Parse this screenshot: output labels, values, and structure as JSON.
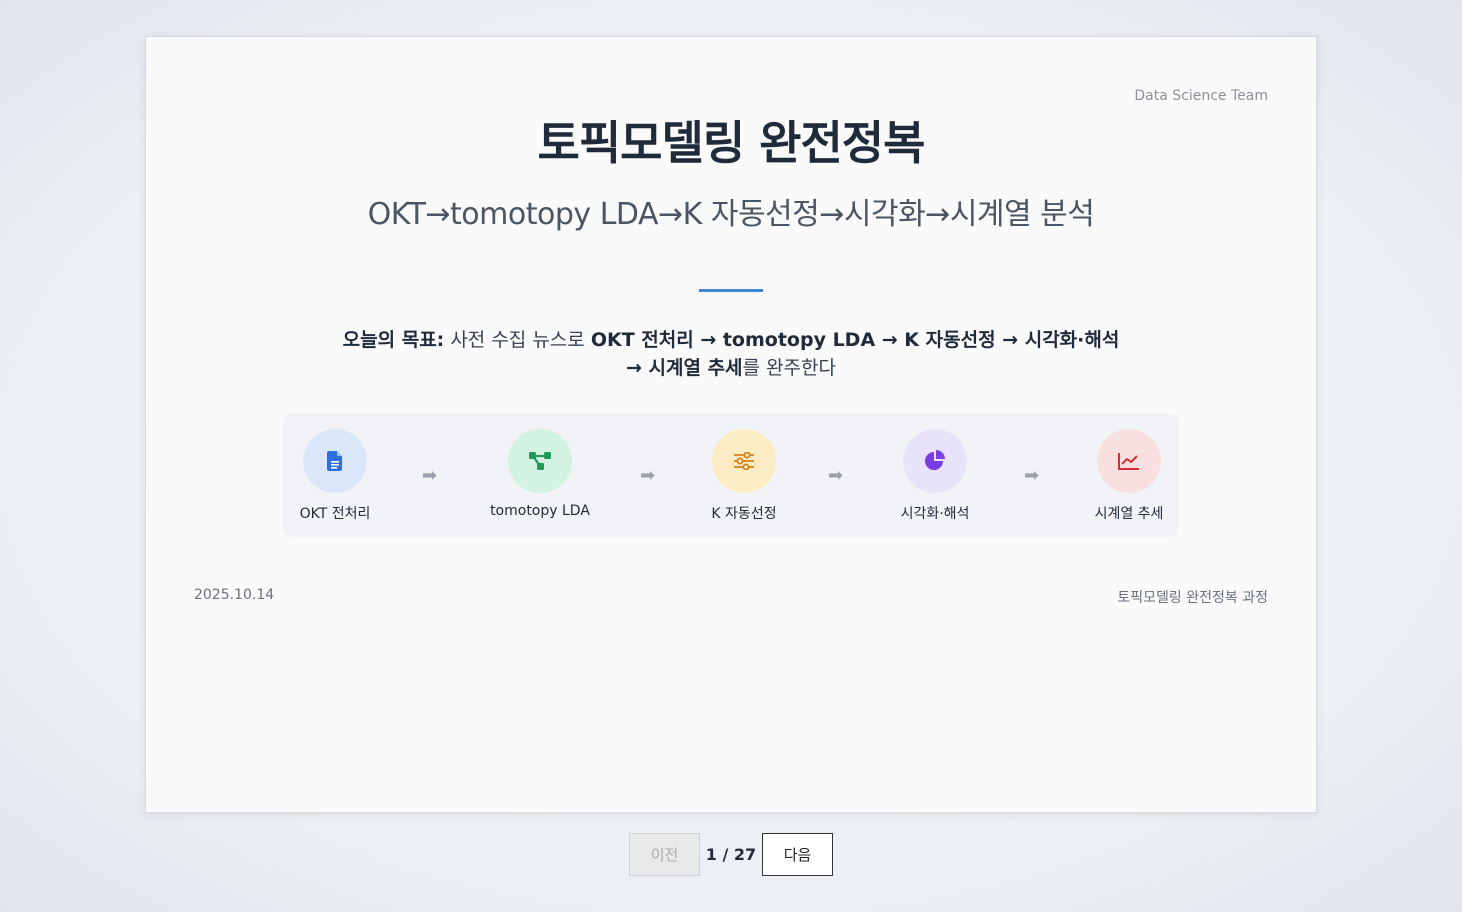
{
  "header": {
    "team": "Data Science Team"
  },
  "slide": {
    "title": "토픽모델링 완전정복",
    "subtitle": "OKT→tomotopy LDA→K 자동선정→시각화→시계열 분석",
    "goal": {
      "label": "오늘의 목표:",
      "t1": " 사전 수집 뉴스로 ",
      "b1": "OKT 전처리 → tomotopy LDA → K 자동선정 → 시각화·해석 → 시계열 추세",
      "t2": "를 완주한다"
    },
    "steps": [
      {
        "label": "OKT 전처리",
        "icon": "document-icon",
        "bg": "#dbe7f9",
        "color": "#2f6fde"
      },
      {
        "label": "tomotopy LDA",
        "icon": "network-icon",
        "bg": "#d3f2e1",
        "color": "#1f9a5b"
      },
      {
        "label": "K 자동선정",
        "icon": "sliders-icon",
        "bg": "#fbecc3",
        "color": "#d9811a"
      },
      {
        "label": "시각화·해석",
        "icon": "pie-chart-icon",
        "bg": "#e9e3fa",
        "color": "#7a3fe0"
      },
      {
        "label": "시계열 추세",
        "icon": "line-chart-icon",
        "bg": "#f9e0e0",
        "color": "#d8303a"
      }
    ],
    "arrow": "➡",
    "footer": {
      "date": "2025.10.14",
      "course": "토픽모델링 완전정복 과정"
    }
  },
  "nav": {
    "prev_label": "이전",
    "page": "1 / 27",
    "next_label": "다음"
  },
  "colors": {
    "accent": "#3f86d6",
    "title": "#1f2a3a"
  }
}
